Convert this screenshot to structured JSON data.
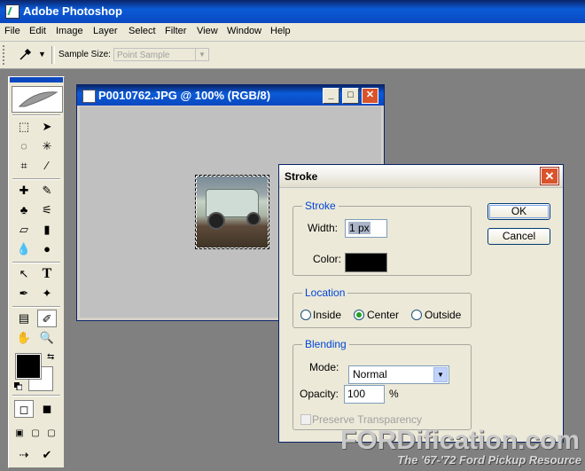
{
  "app": {
    "title": "Adobe Photoshop"
  },
  "menu": [
    "File",
    "Edit",
    "Image",
    "Layer",
    "Select",
    "Filter",
    "View",
    "Window",
    "Help"
  ],
  "options_bar": {
    "sample_size_label": "Sample Size:",
    "sample_size_value": "Point Sample"
  },
  "document": {
    "title": "P0010762.JPG @ 100% (RGB/8)"
  },
  "dialog": {
    "title": "Stroke",
    "stroke_group": "Stroke",
    "width_label": "Width:",
    "width_value": "1 px",
    "color_label": "Color:",
    "stroke_color": "#000000",
    "location_group": "Location",
    "location_options": [
      "Inside",
      "Center",
      "Outside"
    ],
    "location_selected": "Center",
    "blending_group": "Blending",
    "mode_label": "Mode:",
    "mode_value": "Normal",
    "opacity_label": "Opacity:",
    "opacity_value": "100",
    "opacity_unit": "%",
    "preserve_label": "Preserve Transparency",
    "ok_label": "OK",
    "cancel_label": "Cancel"
  },
  "toolbox": {
    "foreground_color": "#000000",
    "background_color": "#ffffff"
  },
  "watermark": {
    "main": "FORDification.com",
    "sub": "The '67-'72 Ford Pickup Resource"
  }
}
